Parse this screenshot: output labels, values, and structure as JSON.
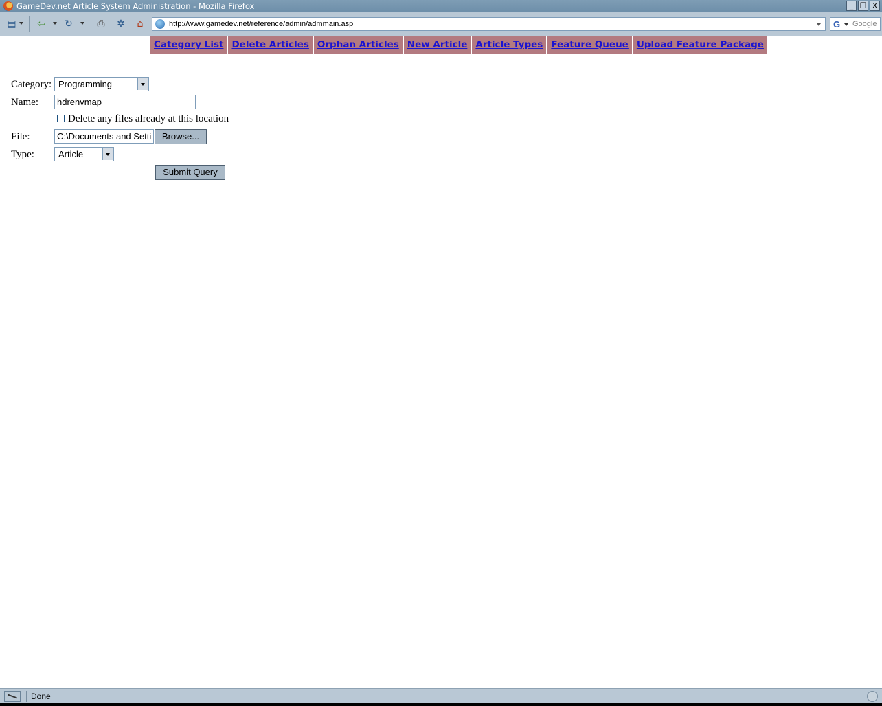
{
  "window": {
    "title": "GameDev.net Article System Administration - Mozilla Firefox",
    "controls": [
      "_",
      "❐",
      "X"
    ]
  },
  "toolbar": {
    "url": "http://www.gamedev.net/reference/admin/admmain.asp",
    "search_placeholder": "Google",
    "search_engine_icon": "G",
    "icons": [
      "menu-icon",
      "back-icon",
      "reload-icon",
      "print-icon",
      "extension-icon",
      "home-icon"
    ]
  },
  "nav": {
    "links": [
      "Category List",
      "Delete Articles",
      "Orphan Articles",
      "New Article",
      "Article Types",
      "Feature Queue",
      "Upload Feature Package"
    ],
    "cell_color": "#b37a80",
    "link_color": "#1b14d1"
  },
  "form": {
    "category_label": "Category:",
    "category_value": "Programming",
    "name_label": "Name:",
    "name_value": "hdrenvmap",
    "delete_checkbox_label": "Delete any files already at this location",
    "delete_checked": false,
    "file_label": "File:",
    "file_value": "C:\\Documents and Setti",
    "browse_label": "Browse...",
    "type_label": "Type:",
    "type_value": "Article",
    "submit_label": "Submit Query"
  },
  "status": {
    "text": "Done"
  }
}
